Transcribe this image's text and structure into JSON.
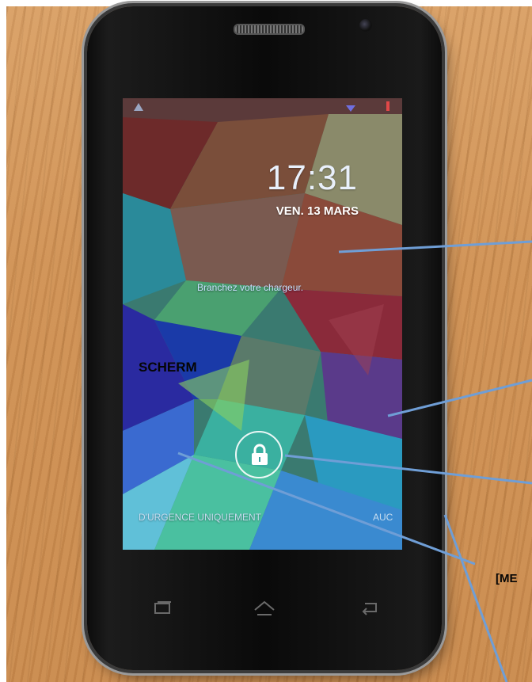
{
  "lockscreen": {
    "time": "17:31",
    "date": "VEN. 13 MARS",
    "charger_message": "Branchez votre chargeur.",
    "emergency_label": "D'URGENCE UNIQUEMENT",
    "right_label_fragment": "AUC"
  },
  "annotations": {
    "screen_label": "SCHERM",
    "callout_fragment": "[ME"
  },
  "icons": {
    "status_warning": "warning-icon",
    "status_signal": "signal-icon",
    "status_battery": "battery-icon",
    "unlock": "lock-icon",
    "nav_recent": "recent-apps-icon",
    "nav_home": "home-icon",
    "nav_back": "back-icon"
  },
  "colors": {
    "annotation_line": "#6f9ed6",
    "date_text": "#ffffff",
    "clock_text": "#e9f0fb"
  }
}
